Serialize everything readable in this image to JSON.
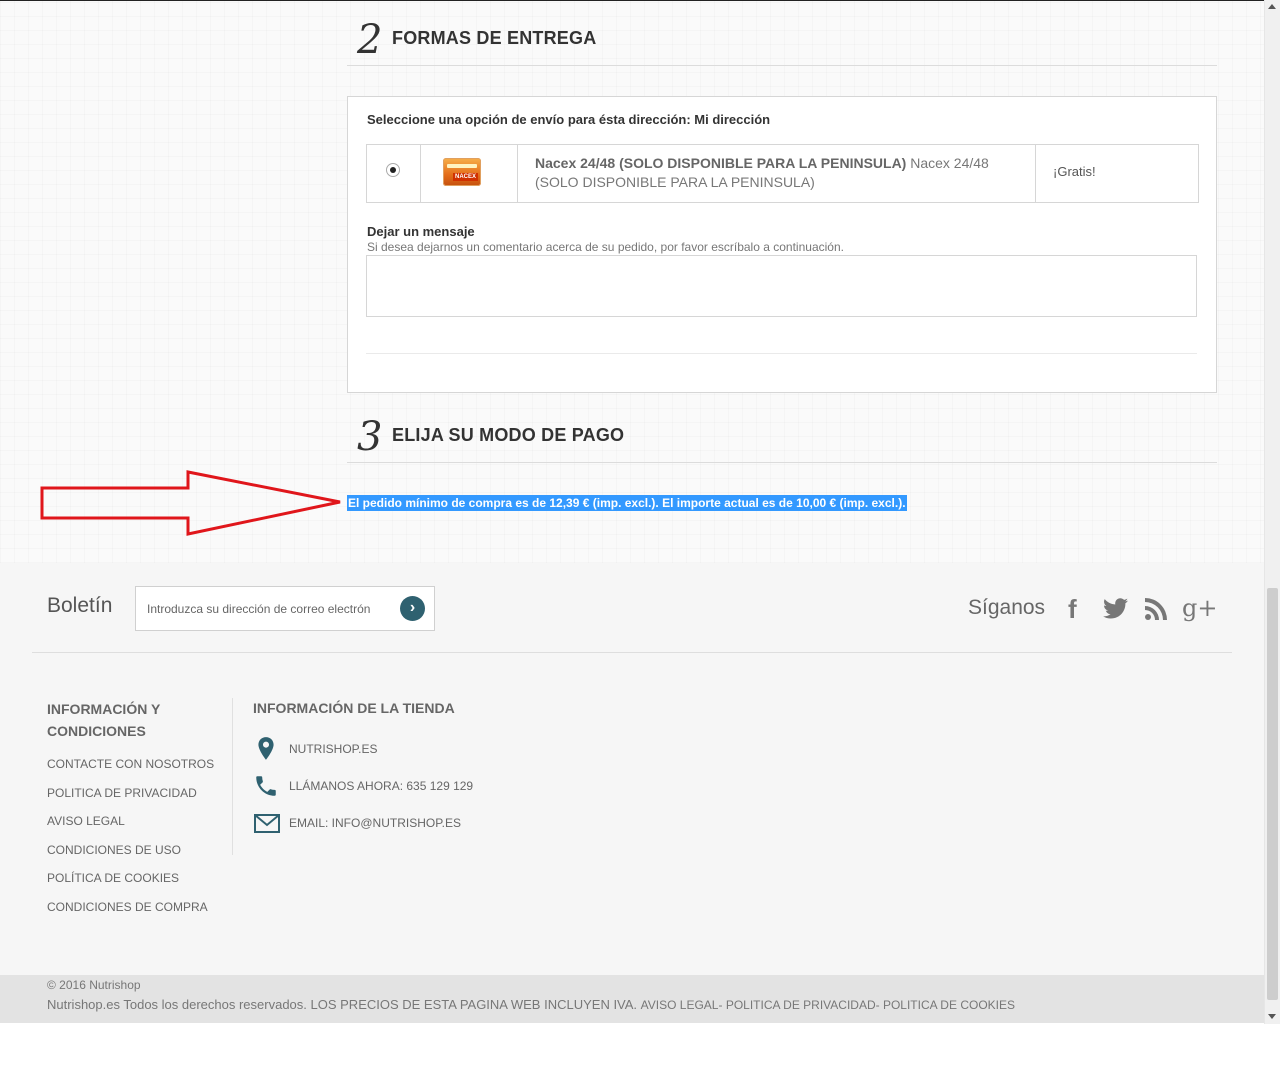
{
  "delivery": {
    "step_number": "2",
    "title": "FORMAS DE ENTREGA",
    "prompt": "Seleccione una opción de envío para ésta dirección: Mi dirección",
    "carrier": {
      "name": "Nacex 24/48 (SOLO DISPONIBLE PARA LA PENINSULA)",
      "description": "Nacex 24/48 (SOLO DISPONIBLE PARA LA PENINSULA)",
      "price": "¡Gratis!",
      "logo_tag": "NACEX",
      "selected": true
    },
    "message_label": "Dejar un mensaje",
    "message_hint": "Si desea dejarnos un comentario acerca de su pedido, por favor escríbalo a continuación."
  },
  "payment": {
    "step_number": "3",
    "title": "ELIJA SU MODO DE PAGO",
    "min_order_warning": "El pedido mínimo de compra es de 12,39 € (imp. excl.). El importe actual es de 10,00 € (imp. excl.)."
  },
  "annotation": {
    "arrow_color": "#e0161b"
  },
  "footer": {
    "newsletter_label": "Boletín",
    "newsletter_placeholder": "Introduzca su dirección de correo electrón",
    "newsletter_button_icon": "chevron-right-icon",
    "follow_label": "Síganos",
    "social_icons": [
      "facebook-icon",
      "twitter-icon",
      "rss-icon",
      "google-plus-icon"
    ],
    "col1_title": "INFORMACIÓN Y CONDICIONES",
    "col1_links": [
      "CONTACTE CON NOSOTROS",
      "POLITICA DE PRIVACIDAD",
      "AVISO LEGAL",
      "CONDICIONES DE USO",
      "POLÍTICA DE COOKIES",
      "CONDICIONES DE COMPRA"
    ],
    "col2_title": "INFORMACIÓN DE LA TIENDA",
    "store_name": "NUTRISHOP.ES",
    "phone": "LLÁMANOS AHORA: 635 129 129",
    "email": "EMAIL: INFO@NUTRISHOP.ES",
    "copyright": "© 2016 Nutrishop",
    "rights": "Nutrishop.es Todos los derechos reservados. LOS PRECIOS DE ESTA PAGINA WEB INCLUYEN IVA.",
    "legal_links": "AVISO LEGAL- POLITICA DE PRIVACIDAD- POLITICA DE COOKIES"
  },
  "colors": {
    "accent": "#2f6170",
    "selection": "#3399ff"
  }
}
